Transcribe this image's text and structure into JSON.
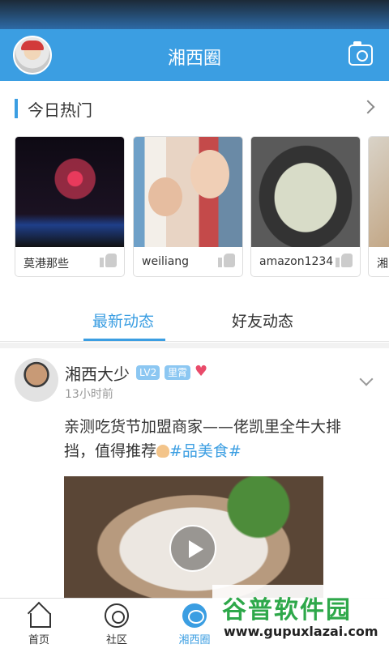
{
  "header": {
    "title": "湘西圈",
    "avatar_icon": "user-avatar",
    "camera_icon": "camera-icon"
  },
  "hot": {
    "label": "今日热门",
    "items": [
      {
        "caption": "莫港那些"
      },
      {
        "caption": "weiliang"
      },
      {
        "caption": "amazon1234"
      },
      {
        "caption": "湘"
      }
    ]
  },
  "tabs": [
    {
      "label": "最新动态",
      "active": true
    },
    {
      "label": "好友动态",
      "active": false
    }
  ],
  "post": {
    "username": "湘西大少",
    "level_badge": "LV2",
    "title_badge": "里霄",
    "time": "13小时前",
    "text_main": "亲测吃货节加盟商家——佬凯里全牛大排挡，值得推荐",
    "hashtag": "#品美食#"
  },
  "nav": [
    {
      "label": "首页",
      "icon": "home-icon"
    },
    {
      "label": "社区",
      "icon": "community-icon"
    },
    {
      "label": "湘西圈",
      "icon": "circle-icon",
      "active": true
    }
  ],
  "watermark": {
    "text": "谷普软件园",
    "url": "www.gupuxlazai.com"
  },
  "colors": {
    "accent": "#3b9ee2",
    "heart": "#e94b6a",
    "watermark_green": "#2ea84a"
  }
}
